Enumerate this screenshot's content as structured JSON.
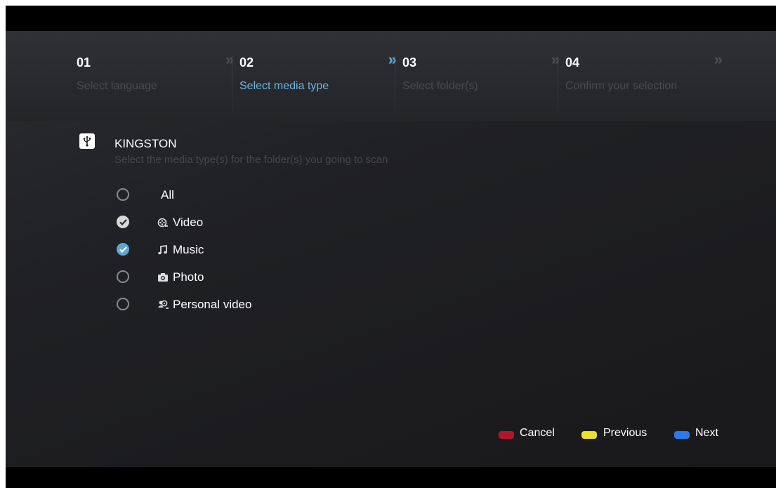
{
  "steps": [
    {
      "number": "01",
      "label": "Select language",
      "state": "done"
    },
    {
      "number": "02",
      "label": "Select media type",
      "state": "active"
    },
    {
      "number": "03",
      "label": "Select folder(s)",
      "state": "upcoming"
    },
    {
      "number": "04",
      "label": "Confirm your selection",
      "state": "upcoming"
    }
  ],
  "step_arrow_glyph": "»",
  "device": {
    "name": "KINGSTON",
    "icon": "usb-icon"
  },
  "hint": "Select the media type(s) for the folder(s) you going to scan",
  "options": [
    {
      "label": "All",
      "checked": false,
      "icon": null
    },
    {
      "label": "Video",
      "checked": true,
      "icon": "video-icon"
    },
    {
      "label": "Music",
      "checked": true,
      "icon": "music-icon",
      "highlighted": true
    },
    {
      "label": "Photo",
      "checked": false,
      "icon": "camera-icon"
    },
    {
      "label": "Personal video",
      "checked": false,
      "icon": "personal-video-icon"
    }
  ],
  "footer": {
    "cancel": "Cancel",
    "previous": "Previous",
    "next": "Next"
  },
  "colors": {
    "accent": "#5fb1e8",
    "cancel_key": "#b0182a",
    "previous_key": "#e8e02a",
    "next_key": "#2a7ae8"
  }
}
